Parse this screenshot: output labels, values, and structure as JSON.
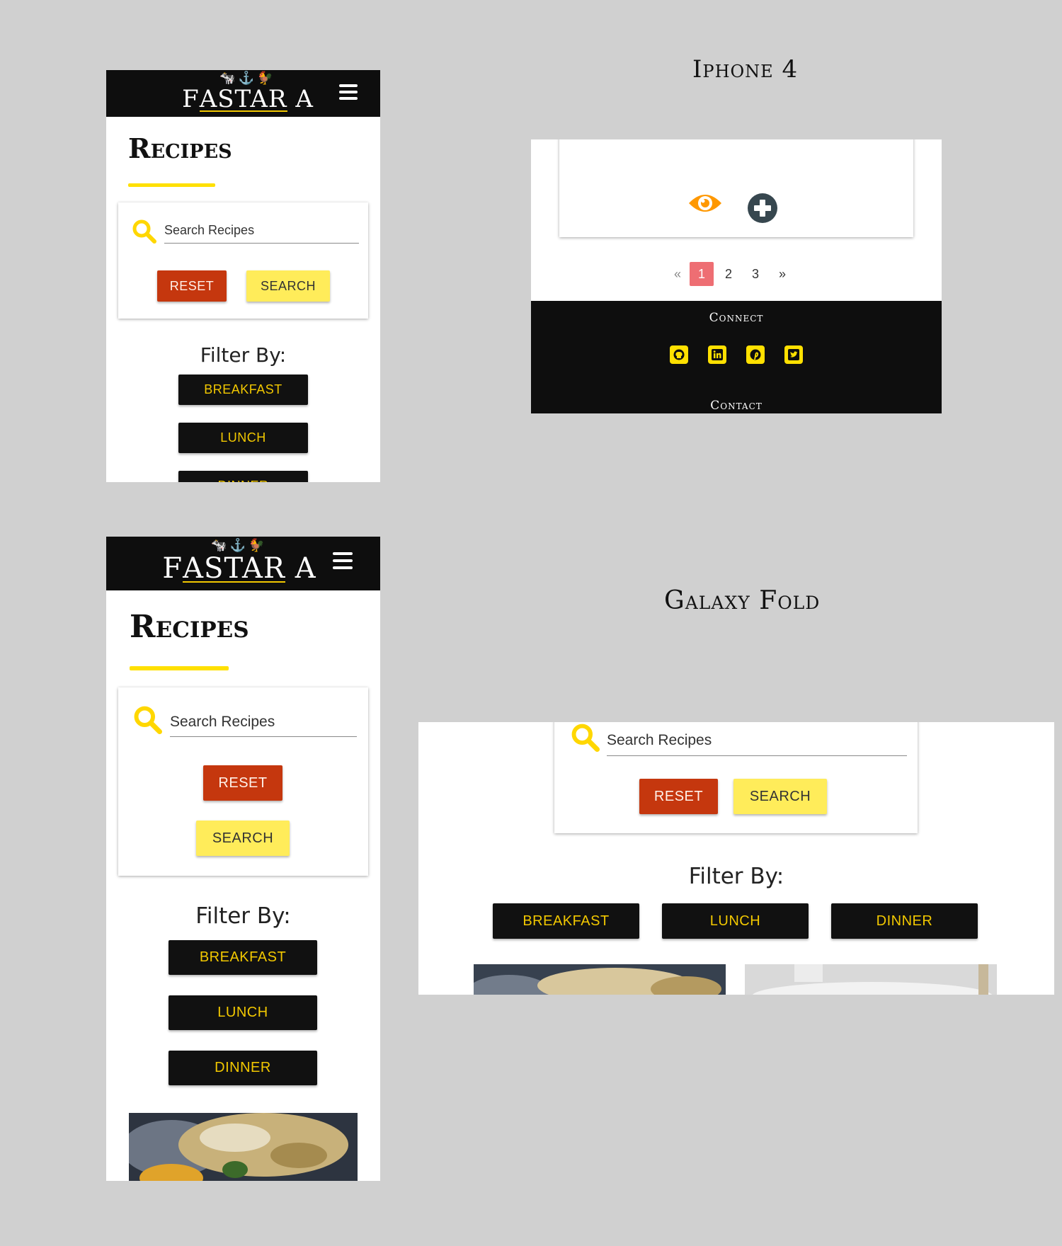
{
  "brand": {
    "name": "FASTARA",
    "name_left": "F",
    "name_mid": "ASTAR",
    "name_right": "A",
    "accent": "#f2c800"
  },
  "labels": {
    "iphone": "Iphone 4",
    "galaxy": "Galaxy Fold"
  },
  "page": {
    "title": "Recipes",
    "search_placeholder": "Search Recipes",
    "reset_label": "RESET",
    "search_label": "SEARCH",
    "filter_title": "Filter By:",
    "filters": [
      "BREAKFAST",
      "LUNCH",
      "DINNER"
    ]
  },
  "pagination": {
    "prev": "«",
    "pages": [
      "1",
      "2",
      "3"
    ],
    "active": "1",
    "next": "»"
  },
  "footer": {
    "connect": "Connect",
    "contact": "Contact",
    "social_icons": [
      "github-icon",
      "linkedin-icon",
      "pinterest-icon",
      "twitter-icon"
    ]
  },
  "colors": {
    "reset": "#c5370e",
    "search": "#ffec5a",
    "filter_bg": "#111111",
    "filter_text": "#f2c800",
    "pager_active": "#ee6e73",
    "eye": "#ff9800",
    "plus": "#37474f"
  }
}
